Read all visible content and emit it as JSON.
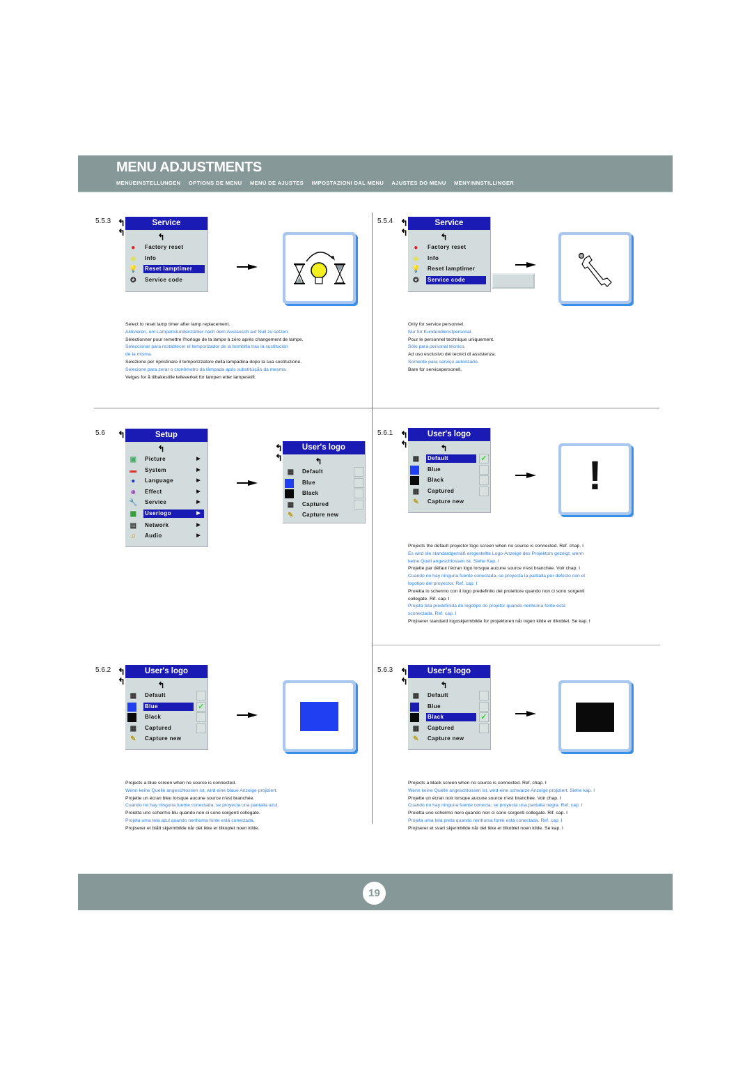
{
  "header": {
    "title": "MENU ADJUSTMENTS",
    "subtitles": [
      "MENÜEINSTELLUNGEN",
      "OPTIONS DE MENU",
      "MENÚ DE AJUSTES",
      "IMPOSTAZIONI DAL MENU",
      "AJUSTES DO MENU",
      "MENYINNSTILLINGER"
    ]
  },
  "icons": {
    "back": "↰",
    "submenu": "▶",
    "check": "✓",
    "exclamation": "!"
  },
  "colors": {
    "menu_title_bg": "#1a1ab4",
    "menu_bg": "#d3dcdc",
    "band": "#869898",
    "translation_text": "#2a7ae8",
    "blue_screen": "#1f3ff0",
    "black_screen": "#0a0a0a"
  },
  "sections": {
    "s553": {
      "number": "5.5.3",
      "menu_title": "Service",
      "items": [
        "Factory reset",
        "Info",
        "Reset lamptimer",
        "Service code"
      ],
      "selected": "Reset lamptimer",
      "preview": "hourglass-lamp-reset",
      "desc": [
        "Select to reset lamp timer after lamp replacement.",
        "Aktivieren, um Lampenstundenzähler nach dem Austausch auf Null zu setzen.",
        "Sélectionner pour remettre l'horloge de la lampe à zéro après changement de lampe.",
        "Seleccionar para restablecer el temporizador de la bombilla tras la sustitución",
        "de la misma.",
        "Selezione per ripristinare il temporizzatore della lampadina dopo la sua sostituzione.",
        "Selecione para zerar o cronômetro da lâmpada após substituição da mesma.",
        "Velges for å tilbakestille telleverket for lampen etter lampeskift."
      ]
    },
    "s554": {
      "number": "5.5.4",
      "menu_title": "Service",
      "items": [
        "Factory reset",
        "Info",
        "Reset lamptimer",
        "Service code"
      ],
      "selected": "Service code",
      "service_code_value": "",
      "preview": "wrench",
      "desc": [
        "Only for service personnel.",
        "Nur für Kundendienstpersonal.",
        "Pour le personnel technique uniquement.",
        "Sólo para personal técnico.",
        "Ad uso esclusivo dei tecnici di assistenza.",
        "Somente para serviço autorizado.",
        "Bare for servicepersonell."
      ]
    },
    "s56": {
      "number": "5.6",
      "menu_title": "Setup",
      "items": [
        "Picture",
        "System",
        "Language",
        "Effect",
        "Service",
        "Userlogo",
        "Network",
        "Audio"
      ],
      "selected": "Userlogo",
      "submenu_title": "User's logo",
      "submenu_items": [
        "Default",
        "Blue",
        "Black",
        "Captured",
        "Capture new"
      ]
    },
    "s561": {
      "number": "5.6.1",
      "menu_title": "User's logo",
      "items": [
        "Default",
        "Blue",
        "Black",
        "Captured",
        "Capture new"
      ],
      "selected": "Default",
      "checked": "Default",
      "preview": "exclamation",
      "desc": [
        "Projects the default projector logo screen when no source is connected. Ref. chap. I",
        "Es wird die standardgemäß eingestellte Logo-Anzeige des Projektors gezeigt, wenn",
        "keine Quell angeschlossen ist. Siehe Kap. I",
        "Projette par défaut l'écran logo lorsque aucune source n'est branchée. Voir chap. I",
        "Cuando no hay ninguna fuente conectada, se proyecta la pantalla por defecto con el",
        "logotipo del proyector. Ref. cap. I",
        "Proietta lo schermo con il logo predefinito del proiettore quando non ci sono sorgenti",
        "collegate. Rif. cap. I",
        "Projeta tela predefinida do logotipo do projetor quando nenhuma fonte está",
        "sconectada. Ref. cap. I",
        "Projiserer standard logoskjermbilde for projektoren når ingen kilde er tilkoblet. Se kap. I"
      ]
    },
    "s562": {
      "number": "5.6.2",
      "menu_title": "User's logo",
      "items": [
        "Default",
        "Blue",
        "Black",
        "Captured",
        "Capture new"
      ],
      "selected": "Blue",
      "checked": "Blue",
      "preview": "blue-screen",
      "desc": [
        "Projects a blue screen when no source is connected.",
        "Wenn keine Quelle angeschlossen ist, wird eine blaue Anzeige projiziert.",
        "Projette un écran bleu lorsque aucune source n'est branchée.",
        "Cuando no hay ninguna fuente conectada, se proyecta una pantalla azul.",
        "Proietta uno schermo blu quando non ci sono sorgenti collegate.",
        "Projeta uma tela azul quando nenhuma fonte está conectada.",
        "Projiserer et blått skjermbilde når det ikke er tilkoplet noen kilde."
      ]
    },
    "s563": {
      "number": "5.6.3",
      "menu_title": "User's logo",
      "items": [
        "Default",
        "Blue",
        "Black",
        "Captured",
        "Capture new"
      ],
      "selected": "Black",
      "checked": "Black",
      "preview": "black-screen",
      "desc": [
        "Projects a black screen when no source is connected. Ref. chap. I",
        "Wenn keine Quelle angeschlossen ist, wird eine schwarze Anzeige projiziert. Siehe kap. I",
        "Projette un écran noir lorsque aucune source n'est branchée. Voir chap. I",
        "Cuando no hay ninguna fuente conecta, se proyecta una pantalla negra. Ref. cap. I",
        "Proietta uno schermo nero quando non ci sono sorgenti collegate. Rif. cap. I",
        "Projeta uma tela preta quando nenhuma fonte está conectada. Ref. cap. I",
        "Projiserer et svart skjermbilde når det ikke er tilkoblet noen kilde. Se kap. I"
      ]
    }
  },
  "footer": {
    "page_number": "19"
  }
}
